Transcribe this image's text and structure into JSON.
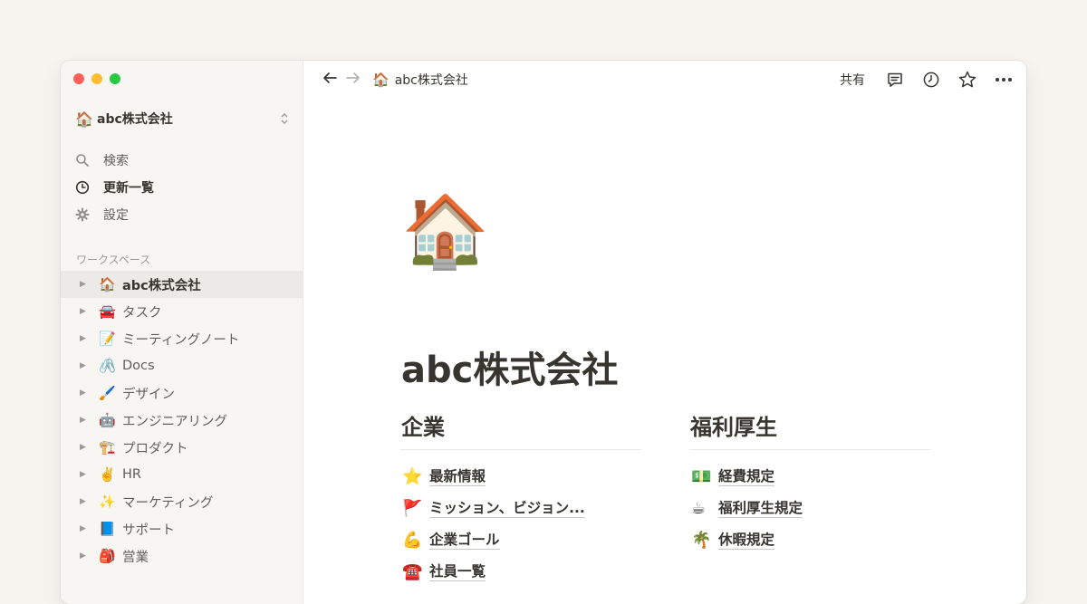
{
  "window": {
    "title": "abc株式会社"
  },
  "sidebar": {
    "workspace_name": "abc株式会社",
    "workspace_emoji": "🏠",
    "nav": [
      {
        "label": "検索",
        "icon": "search-icon"
      },
      {
        "label": "更新一覧",
        "icon": "clock-icon"
      },
      {
        "label": "設定",
        "icon": "gear-icon"
      }
    ],
    "section_label": "ワークスペース",
    "pages": [
      {
        "emoji": "🏠",
        "label": "abc株式会社"
      },
      {
        "emoji": "🚘",
        "label": "タスク"
      },
      {
        "emoji": "📝",
        "label": "ミーティングノート"
      },
      {
        "emoji": "🖇️",
        "label": "Docs"
      },
      {
        "emoji": "🖌️",
        "label": "デザイン"
      },
      {
        "emoji": "🤖",
        "label": "エンジニアリング"
      },
      {
        "emoji": "🏗️",
        "label": "プロダクト"
      },
      {
        "emoji": "✌️",
        "label": "HR"
      },
      {
        "emoji": "✨",
        "label": "マーケティング"
      },
      {
        "emoji": "📘",
        "label": "サポート"
      },
      {
        "emoji": "🎒",
        "label": "営業"
      }
    ]
  },
  "topbar": {
    "breadcrumb_emoji": "🏠",
    "breadcrumb": "abc株式会社",
    "share_label": "共有",
    "icons": [
      "comment-icon",
      "history-icon",
      "star-icon",
      "more-icon"
    ]
  },
  "page": {
    "icon": "🏠",
    "title": "abc株式会社",
    "columns": [
      {
        "heading": "企業",
        "items": [
          {
            "emoji": "⭐",
            "label": "最新情報"
          },
          {
            "emoji": "🚩",
            "label": "ミッション、ビジョン..."
          },
          {
            "emoji": "💪",
            "label": "企業ゴール"
          },
          {
            "emoji": "☎️",
            "label": "社員一覧"
          }
        ]
      },
      {
        "heading": "福利厚生",
        "items": [
          {
            "emoji": "💵",
            "label": "経費規定"
          },
          {
            "emoji": "☕",
            "label": "福利厚生規定"
          },
          {
            "emoji": "🌴",
            "label": "休暇規定"
          }
        ]
      }
    ]
  },
  "colors": {
    "sidebar_bg": "#f7f6f3",
    "text": "#37352f",
    "muted": "#9b9a97",
    "selected_row": "#ebeae6",
    "page_bg": "#f7f4f0"
  }
}
